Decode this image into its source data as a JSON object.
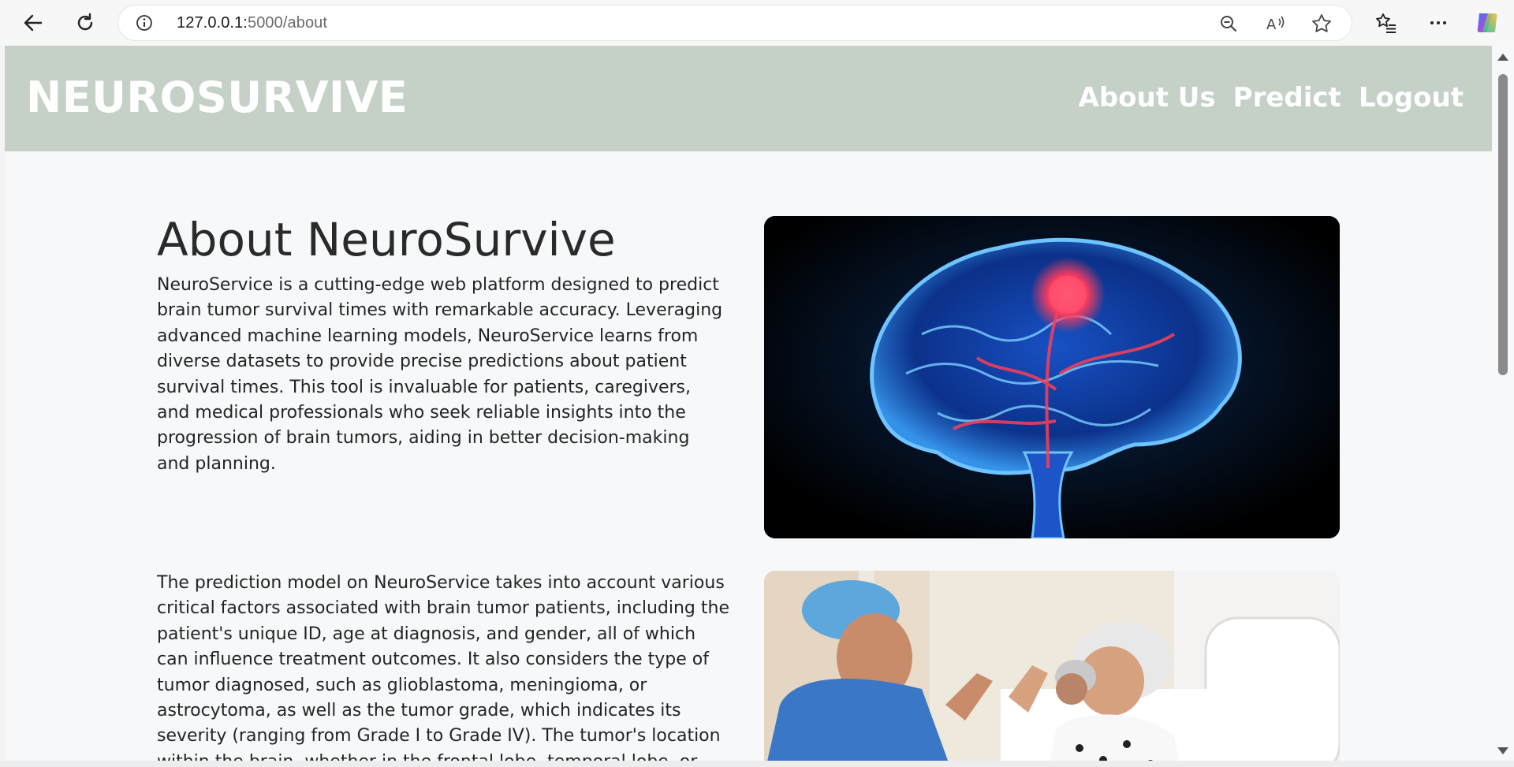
{
  "browser": {
    "url_host": "127.0.0.1:",
    "url_path": "5000/about",
    "icons": [
      "back-arrow-icon",
      "reload-icon",
      "info-icon",
      "zoom-out-icon",
      "read-aloud-icon",
      "favorite-star-icon",
      "favorites-list-icon",
      "more-icon",
      "copilot-icon"
    ]
  },
  "header": {
    "brand": "NEUROSURVIVE",
    "nav": [
      "About Us",
      "Predict",
      "Logout"
    ],
    "bg_color": "#c5d1c7"
  },
  "main": {
    "title": "About NeuroSurvive",
    "paragraph1": "NeuroService is a cutting-edge web platform designed to predict brain tumor survival times with remarkable accuracy. Leveraging advanced machine learning models, NeuroService learns from diverse datasets to provide precise predictions about patient survival times. This tool is invaluable for patients, caregivers, and medical professionals who seek reliable insights into the progression of brain tumors, aiding in better decision-making and planning.",
    "paragraph2": "The prediction model on NeuroService takes into account various critical factors associated with brain tumor patients, including the patient's unique ID, age at diagnosis, and gender, all of which can influence treatment outcomes. It also considers the type of tumor diagnosed, such as glioblastoma, meningioma, or astrocytoma, as well as the tumor grade, which indicates its severity (ranging from Grade I to Grade IV). The tumor's location within the brain, whether in the frontal lobe, temporal lobe, or other areas, is another crucial"
  }
}
